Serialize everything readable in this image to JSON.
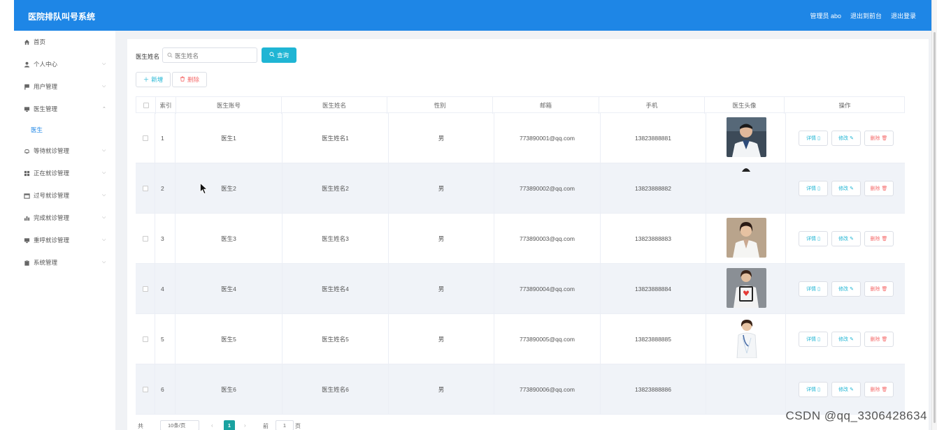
{
  "header": {
    "title": "医院排队叫号系统",
    "admin_label": "管理员 abo",
    "to_front": "退出到前台",
    "logout": "退出登录"
  },
  "sidebar": {
    "items": [
      {
        "label": "首页",
        "icon": "home-icon"
      },
      {
        "label": "个人中心",
        "icon": "user-icon"
      },
      {
        "label": "用户管理",
        "icon": "flag-icon"
      },
      {
        "label": "医生管理",
        "icon": "monitor-icon"
      },
      {
        "label": "医生",
        "icon": ""
      },
      {
        "label": "等待就诊管理",
        "icon": "bell-icon"
      },
      {
        "label": "正在就诊管理",
        "icon": "grid-icon"
      },
      {
        "label": "过号就诊管理",
        "icon": "calendar-icon"
      },
      {
        "label": "完成就诊管理",
        "icon": "bar-chart-icon"
      },
      {
        "label": "重呼就诊管理",
        "icon": "monitor-icon"
      },
      {
        "label": "系统管理",
        "icon": "clipboard-icon"
      }
    ]
  },
  "search": {
    "label": "医生姓名",
    "placeholder": "医生姓名",
    "query_button": "查询"
  },
  "actions": {
    "add": "新增",
    "delete": "删除"
  },
  "table": {
    "columns": [
      "索引",
      "医生账号",
      "医生姓名",
      "性别",
      "邮箱",
      "手机",
      "医生头像",
      "操作"
    ],
    "rows": [
      {
        "index": "1",
        "account": "医生1",
        "name": "医生姓名1",
        "gender": "男",
        "email": "773890001@qq.com",
        "phone": "13823888881"
      },
      {
        "index": "2",
        "account": "医生2",
        "name": "医生姓名2",
        "gender": "男",
        "email": "773890002@qq.com",
        "phone": "13823888882"
      },
      {
        "index": "3",
        "account": "医生3",
        "name": "医生姓名3",
        "gender": "男",
        "email": "773890003@qq.com",
        "phone": "13823888883"
      },
      {
        "index": "4",
        "account": "医生4",
        "name": "医生姓名4",
        "gender": "男",
        "email": "773890004@qq.com",
        "phone": "13823888884"
      },
      {
        "index": "5",
        "account": "医生5",
        "name": "医生姓名5",
        "gender": "男",
        "email": "773890005@qq.com",
        "phone": "13823888885"
      },
      {
        "index": "6",
        "account": "医生6",
        "name": "医生姓名6",
        "gender": "男",
        "email": "773890006@qq.com",
        "phone": "13823888886"
      }
    ],
    "op_detail": "详情",
    "op_edit": "修改",
    "op_delete": "删除"
  },
  "pagination": {
    "total": "共 6 条",
    "page_size": "10条/页",
    "current_page": "1",
    "goto_label": "前往",
    "goto_value": "1",
    "page_suffix": "页"
  },
  "watermark": "CSDN @qq_3306428634",
  "colors": {
    "header": "#1e86e6",
    "accent": "#1fb5d4",
    "danger": "#f56c6c",
    "page_active": "#1aa2a0"
  }
}
